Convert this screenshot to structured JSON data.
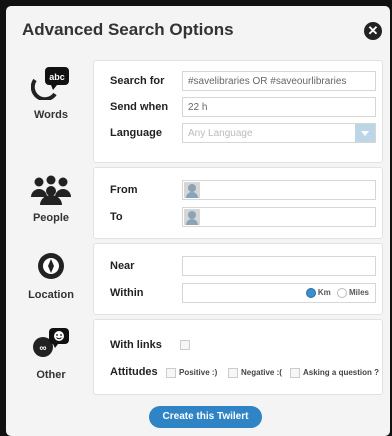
{
  "dialog": {
    "title": "Advanced Search Options",
    "close_glyph": "✕"
  },
  "words": {
    "label": "Words",
    "icon_text": "abc",
    "search_for_label": "Search for",
    "search_for_value": "#savelibraries OR #saveourlibraries",
    "send_when_label": "Send when",
    "send_when_value": "22 h",
    "language_label": "Language",
    "language_placeholder": "Any Language"
  },
  "people": {
    "label": "People",
    "from_label": "From",
    "to_label": "To"
  },
  "location": {
    "label": "Location",
    "near_label": "Near",
    "within_label": "Within",
    "unit_km": "Km",
    "unit_miles": "Miles",
    "selected_unit": "Km"
  },
  "other": {
    "label": "Other",
    "with_links_label": "With links",
    "attitudes_label": "Attitudes",
    "positive": "Positive :)",
    "negative": "Negative :(",
    "question": "Asking a question ?"
  },
  "submit_label": "Create this Twilert",
  "colors": {
    "accent": "#2e84c4",
    "select_arrow": "#bcd6e6",
    "radio_on": "#3a8fd0"
  }
}
